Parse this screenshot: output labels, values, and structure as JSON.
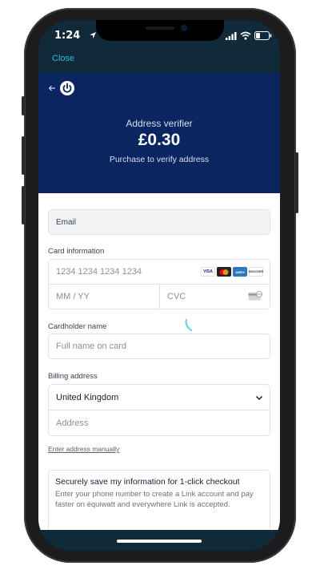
{
  "status_bar": {
    "time": "1:24"
  },
  "nav": {
    "close_label": "Close"
  },
  "header": {
    "product_name": "Address verifier",
    "price": "£0.30",
    "purpose": "Purchase to verify address"
  },
  "form": {
    "email_label": "Email",
    "card_info_label": "Card information",
    "card_number_placeholder": "1234 1234 1234 1234",
    "expiry_placeholder": "MM / YY",
    "cvc_placeholder": "CVC",
    "card_brands": [
      "VISA",
      "MC",
      "AMEX",
      "DISCOVER"
    ],
    "cardholder_label": "Cardholder name",
    "cardholder_placeholder": "Full name on card",
    "billing_label": "Billing address",
    "country_value": "United Kingdom",
    "address_placeholder": "Address",
    "manual_link": "Enter address manually"
  },
  "link_box": {
    "title": "Securely save my information for 1-click checkout",
    "description": "Enter your phone number to create a Link account and pay faster on equiwatt and everywhere Link is accepted."
  },
  "colors": {
    "header_bg": "#0b2560",
    "nav_bg": "#102a3a",
    "accent": "#30b6e6"
  }
}
